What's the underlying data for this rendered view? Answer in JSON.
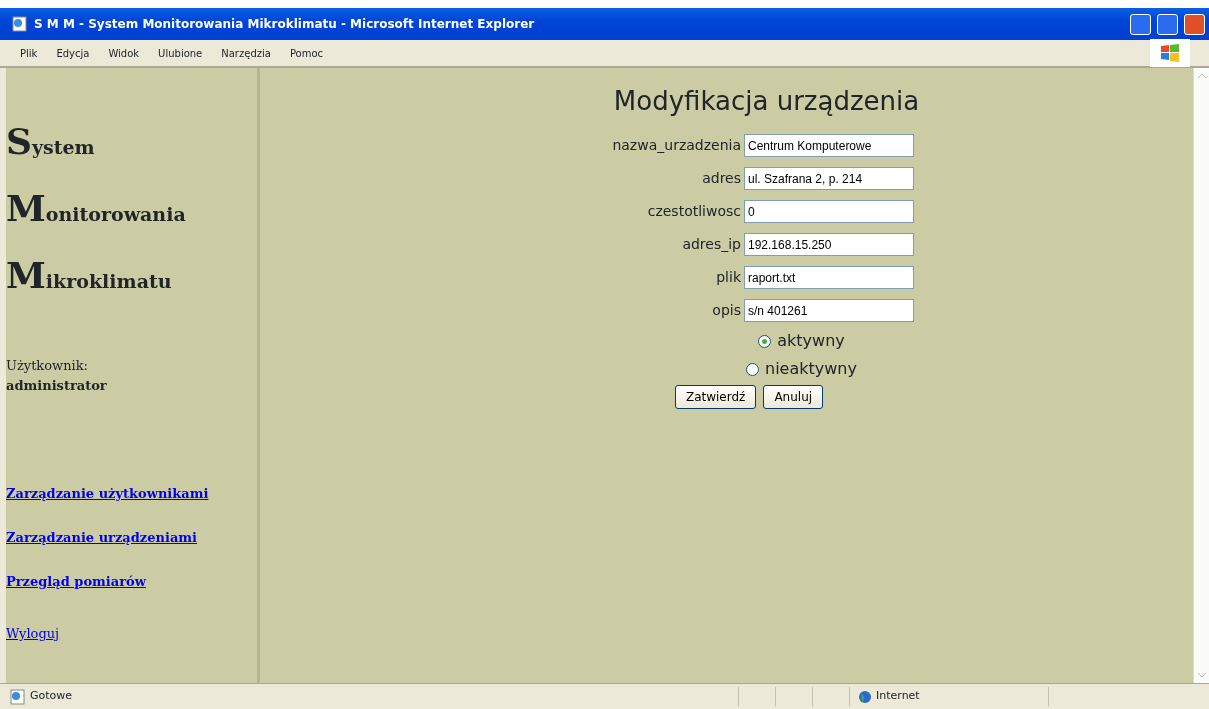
{
  "window": {
    "title": "S M M - System Monitorowania Mikroklimatu - Microsoft Internet Explorer"
  },
  "menu": [
    "Plik",
    "Edycja",
    "Widok",
    "Ulubione",
    "Narzędzia",
    "Pomoc"
  ],
  "sidebar": {
    "title_words": [
      "System",
      "Monitorowania",
      "Mikroklimatu"
    ],
    "user_label": "Użytkownik:",
    "user_name": "administrator",
    "links": [
      {
        "label": "Zarządzanie użytkownikami",
        "kind": "bold"
      },
      {
        "label": "Zarządzanie urządzeniami",
        "kind": "bold"
      },
      {
        "label": "Przegląd pomiarów",
        "kind": "bold"
      },
      {
        "label": "Wyloguj",
        "kind": "plain"
      }
    ]
  },
  "form": {
    "heading": "Modyfikacja urządzenia",
    "fields": [
      {
        "label": "nazwa_urzadzenia",
        "value": "Centrum Komputerowe"
      },
      {
        "label": "adres",
        "value": "ul. Szafrana 2, p. 214"
      },
      {
        "label": "czestotliwosc",
        "value": "0"
      },
      {
        "label": "adres_ip",
        "value": "192.168.15.250"
      },
      {
        "label": "plik",
        "value": "raport.txt"
      },
      {
        "label": "opis",
        "value": "s/n 401261"
      }
    ],
    "radios": [
      {
        "label": "aktywny",
        "selected": true
      },
      {
        "label": "nieaktywny",
        "selected": false
      }
    ],
    "buttons": [
      "Zatwierdź",
      "Anuluj"
    ]
  },
  "status_bar": {
    "text": "Gotowe",
    "zone": "Internet"
  }
}
